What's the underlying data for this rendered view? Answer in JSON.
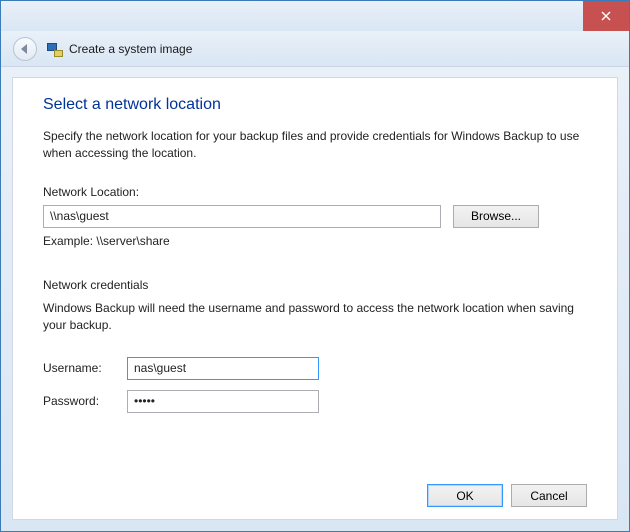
{
  "window": {
    "wizard_title": "Create a system image"
  },
  "page": {
    "heading": "Select a network location",
    "description": "Specify the network location for your backup files and provide credentials for Windows Backup to use when accessing the location."
  },
  "network": {
    "label": "Network Location:",
    "value": "\\\\nas\\guest",
    "browse_label": "Browse...",
    "example": "Example: \\\\server\\share"
  },
  "credentials": {
    "heading": "Network credentials",
    "description": "Windows Backup will need the username and password to access the network location when saving your backup.",
    "username_label": "Username:",
    "username_value": "nas\\guest",
    "password_label": "Password:",
    "password_value": "•••••"
  },
  "buttons": {
    "ok": "OK",
    "cancel": "Cancel"
  }
}
